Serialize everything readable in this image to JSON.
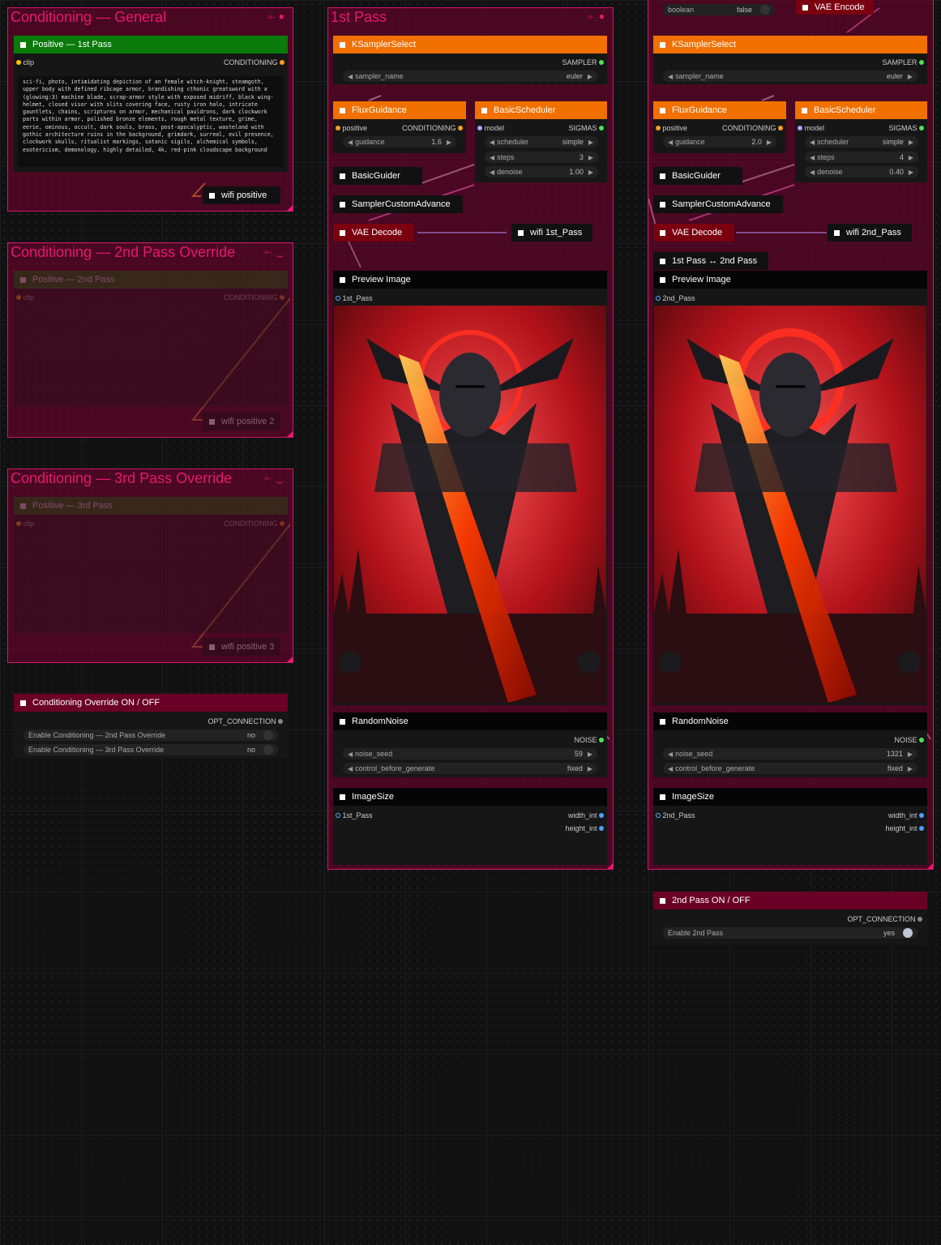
{
  "colors": {
    "accent": "#e8176f",
    "group_bg": "#5a0024",
    "orange_header": "#f07000",
    "green_header": "#0a7a0a"
  },
  "groups": {
    "cond_general": {
      "title": "Conditioning — General"
    },
    "cond_2nd": {
      "title": "Conditioning — 2nd Pass Override"
    },
    "cond_3rd": {
      "title": "Conditioning — 3rd Pass Override"
    },
    "pass1": {
      "title": "1st Pass"
    }
  },
  "positive_1st": {
    "title": "Positive — 1st Pass",
    "in": "clip",
    "out": "CONDITIONING",
    "prompt": "sci-fi, photo, intimidating depiction of an female witch-knight, steamgoth, upper body with defined ribcage armor, brandishing cthonic greatsword with a (glowing:3) machine blade, scrap-armor style with exposed midriff, black wing-helmet, closed visor with slits covering face, rusty iron halo, intricate gauntlets, chains, scriptures on armor, mechanical pauldrons, dark clockwork parts within armor, polished bronze elements, rough metal texture, grime, eerie, ominous, occult, dark souls, brass, post-apocalyptic, wasteland with gothic architecture ruins in the background, grimdark, surreal, evil presence, clockwork skulls, ritualist markings, satanic sigils, alchemical symbols, esotericism, demonology, highly detailed, 4k, red-pink cloudscape background"
  },
  "wifi_positive": "wifi positive",
  "positive_2nd": {
    "title": "Positive — 2nd Pass",
    "in": "clip",
    "out": "CONDITIONING",
    "wifi": "wifi positive 2"
  },
  "positive_3rd": {
    "title": "Positive — 3rd Pass",
    "in": "clip",
    "out": "CONDITIONING",
    "wifi": "wifi positive 3"
  },
  "cond_switch": {
    "title": "Conditioning Override ON / OFF",
    "out": "OPT_CONNECTION",
    "w1_label": "Enable Conditioning — 2nd Pass Override",
    "w1_value": "no",
    "w2_label": "Enable Conditioning — 3rd Pass Override",
    "w2_value": "no"
  },
  "top_bar": {
    "boolean_label": "boolean",
    "boolean_value": "false",
    "vae_encode": "VAE Encode"
  },
  "common": {
    "ksampler_title": "KSamplerSelect",
    "sampler_out": "SAMPLER",
    "sampler_name": "sampler_name",
    "sampler_value": "euler",
    "flux_title": "FluxGuidance",
    "flux_in": "positive",
    "flux_out": "CONDITIONING",
    "guidance_label": "guidance",
    "sched_title": "BasicScheduler",
    "sched_in": "model",
    "sched_out": "SIGMAS",
    "scheduler_label": "scheduler",
    "scheduler_value": "simple",
    "steps_label": "steps",
    "denoise_label": "denoise",
    "guider": "BasicGuider",
    "sca": "SamplerCustomAdvance",
    "vae_decode": "VAE Decode",
    "preview_title": "Preview Image",
    "noise_title": "RandomNoise",
    "noise_out": "NOISE",
    "seed_label": "noise_seed",
    "control_label": "control_before_generate",
    "control_value": "fixed",
    "imgsize_title": "ImageSize",
    "width_out": "width_int",
    "height_out": "height_int"
  },
  "pass1_vals": {
    "guidance": "1.6",
    "steps": "3",
    "denoise": "1.00",
    "wifi": "wifi 1st_Pass",
    "preview_in": "1st_Pass",
    "seed": "59",
    "imgsize_in": "1st_Pass"
  },
  "pass2_vals": {
    "guidance": "2.0",
    "steps": "4",
    "denoise": "0.40",
    "wifi": "wifi 2nd_Pass",
    "preview_in": "2nd_Pass",
    "seed": "1321",
    "imgsize_in": "2nd_Pass",
    "bridge": "1st Pass ↔ 2nd Pass"
  },
  "pass2_switch": {
    "title": "2nd Pass  ON / OFF",
    "out": "OPT_CONNECTION",
    "w_label": "Enable 2nd Pass",
    "w_value": "yes"
  }
}
